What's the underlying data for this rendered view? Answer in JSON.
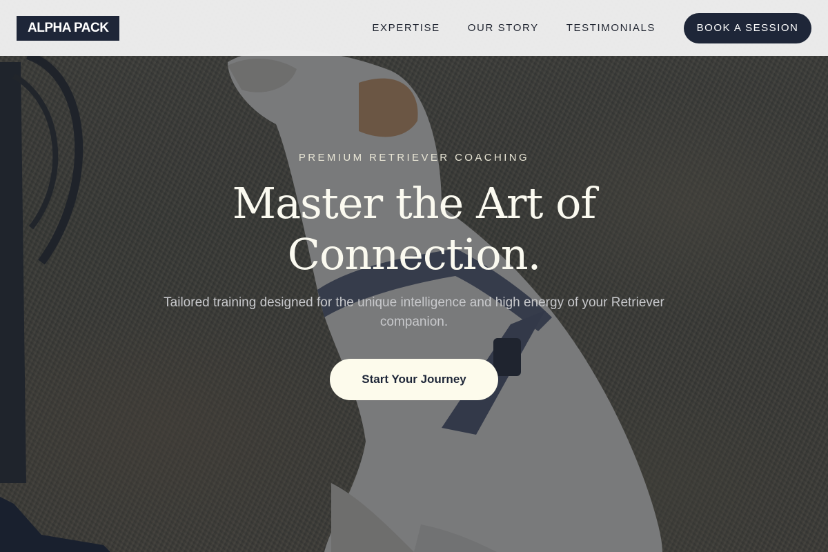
{
  "brand": {
    "logo_text": "ALPHA PACK"
  },
  "nav": {
    "links": [
      "EXPERTISE",
      "OUR STORY",
      "TESTIMONIALS"
    ],
    "cta_label": "BOOK A SESSION"
  },
  "hero": {
    "eyebrow": "PREMIUM RETRIEVER COACHING",
    "headline_line1": "Master the Art of",
    "headline_line2": "Connection.",
    "subtext": "Tailored training designed for the unique intelligence and high energy of your Retriever companion.",
    "cta_label": "Start Your Journey",
    "background_image": "retriever-dog-in-harness-on-grass"
  },
  "colors": {
    "navy": "#1e2638",
    "cream": "#fdfbec",
    "header_bg": "#f0f0f0"
  }
}
